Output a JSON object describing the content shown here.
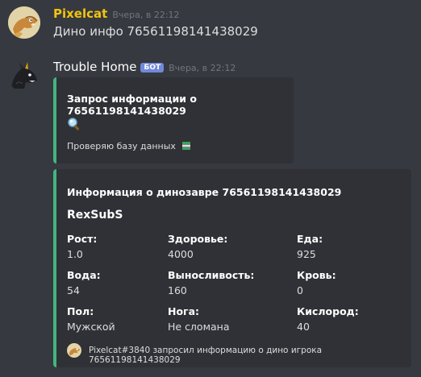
{
  "messages": [
    {
      "author": "Pixelcat",
      "author_color": "#f1c40f",
      "timestamp": "Вчера, в 22:12",
      "text": "Дино инфо 76561198141438029",
      "avatar": "lizard-avatar"
    },
    {
      "author": "Trouble Home",
      "author_color": "#ffffff",
      "badge": "БОТ",
      "timestamp": "Вчера, в 22:12",
      "avatar": "dragon-avatar",
      "embeds": [
        {
          "title": "Запрос информации о 76561198141438029",
          "icon": "magnifier-emoji",
          "text": "Проверяю базу данных",
          "text_icon": "books-emoji",
          "accent": "#43b581"
        },
        {
          "title": "Информация о динозавре 76561198141438029",
          "subtitle": "RexSubS",
          "accent": "#43b581",
          "fields": [
            {
              "name": "Рост:",
              "value": "1.0"
            },
            {
              "name": "Здоровье:",
              "value": "4000"
            },
            {
              "name": "Еда:",
              "value": "925"
            },
            {
              "name": "Вода:",
              "value": "54"
            },
            {
              "name": "Выносливость:",
              "value": "160"
            },
            {
              "name": "Кровь:",
              "value": "0"
            },
            {
              "name": "Пол:",
              "value": "Мужской"
            },
            {
              "name": "Нога:",
              "value": "Не сломана"
            },
            {
              "name": "Кислород:",
              "value": "40"
            }
          ],
          "footer": "Pixelcat#3840 запросил информацию о дино игрока 76561198141438029"
        }
      ]
    }
  ]
}
